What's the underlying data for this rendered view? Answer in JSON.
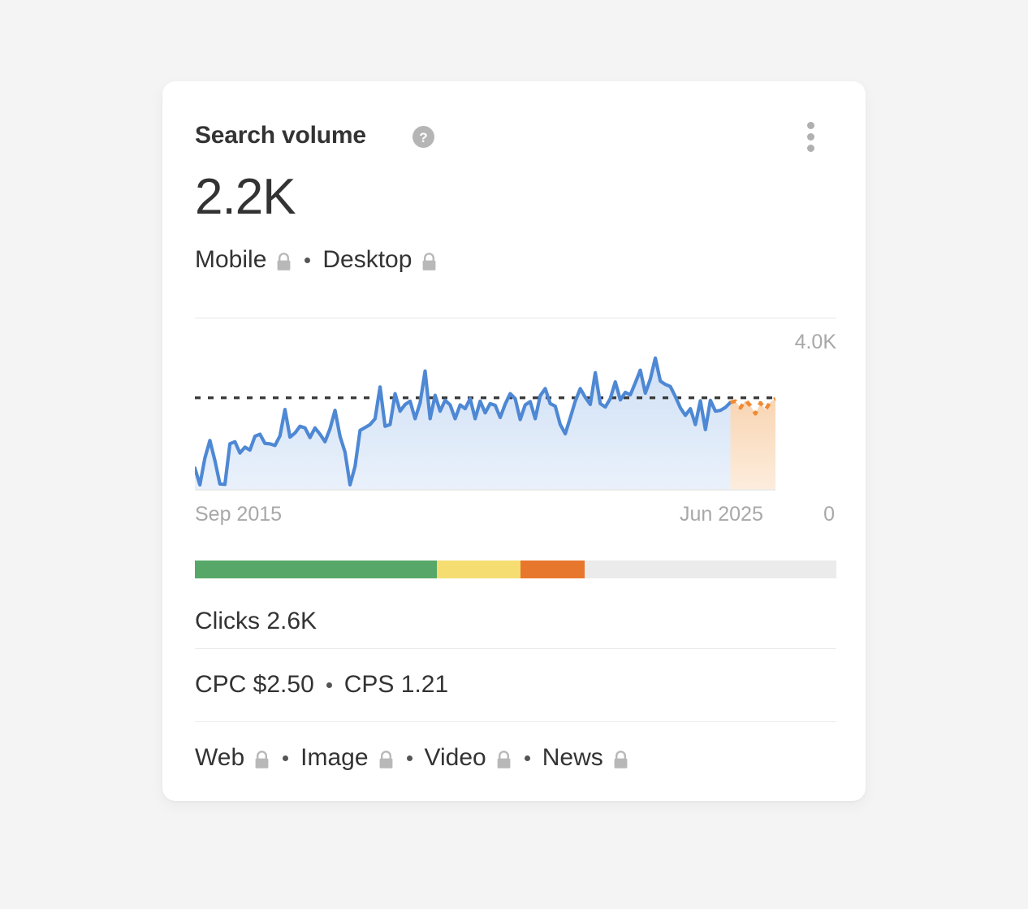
{
  "card": {
    "title": "Search volume",
    "help_icon": "help-circle-icon",
    "menu_icon": "kebab-menu-icon",
    "value": "2.2K",
    "devices": [
      {
        "label": "Mobile",
        "icon": "lock-icon"
      },
      {
        "label": "Desktop",
        "icon": "lock-icon"
      }
    ],
    "separator": "·",
    "clicks_label": "Clicks 2.6K",
    "metrics": [
      {
        "label": "CPC $2.50"
      },
      {
        "label": "CPS 1.21"
      }
    ],
    "result_types": [
      {
        "label": "Web",
        "icon": "lock-icon"
      },
      {
        "label": "Image",
        "icon": "lock-icon"
      },
      {
        "label": "Video",
        "icon": "lock-icon"
      },
      {
        "label": "News",
        "icon": "lock-icon"
      }
    ],
    "difficulty_bar": {
      "segments": [
        {
          "name": "easy",
          "color": "#57a868",
          "percent": 37.7
        },
        {
          "name": "medium",
          "color": "#f5dd72",
          "percent": 13.0
        },
        {
          "name": "hard",
          "color": "#e8772e",
          "percent": 10.1
        },
        {
          "name": "remaining",
          "color": "#ebebeb",
          "percent": 39.2
        }
      ]
    }
  },
  "chart_data": {
    "type": "area",
    "title": "Search volume",
    "xlabel": "",
    "ylabel": "",
    "x_tick_labels": [
      "Sep 2015",
      "Jun 2025"
    ],
    "y_tick_labels": [
      "4.0K",
      "0"
    ],
    "ylim": [
      0,
      4000
    ],
    "grid": false,
    "average_line": 2200,
    "average_line_style": "dashed",
    "line_color": "#4e88d4",
    "fill_color": "#dce7f7",
    "forecast_color": "#f08a33",
    "forecast_fill": "#fbe2cd",
    "forecast_start_index": 107,
    "series": [
      {
        "name": "Search volume",
        "values": [
          520,
          120,
          760,
          1180,
          700,
          140,
          130,
          1100,
          1150,
          880,
          1020,
          950,
          1280,
          1330,
          1110,
          1100,
          1060,
          1290,
          1920,
          1260,
          1360,
          1520,
          1480,
          1250,
          1480,
          1330,
          1150,
          1460,
          1900,
          1280,
          900,
          120,
          560,
          1420,
          1490,
          1560,
          1700,
          2460,
          1520,
          1560,
          2300,
          1880,
          2040,
          2120,
          1700,
          2080,
          2840,
          1700,
          2260,
          1880,
          2140,
          2030,
          1700,
          2030,
          1940,
          2180,
          1700,
          2120,
          1840,
          2060,
          2020,
          1730,
          2050,
          2300,
          2180,
          1680,
          2030,
          2110,
          1700,
          2250,
          2420,
          2060,
          2000,
          1560,
          1340,
          1720,
          2120,
          2420,
          2210,
          2040,
          2800,
          2060,
          1980,
          2180,
          2580,
          2150,
          2330,
          2270,
          2560,
          2860,
          2310,
          2650,
          3150,
          2600,
          2520,
          2470,
          2230,
          1960,
          1780,
          1940,
          1560,
          2130,
          1440,
          2140,
          1880,
          1900,
          1970,
          2090,
          2120,
          1960,
          2140,
          2010,
          1820,
          2080,
          1920,
          2100,
          2180
        ]
      }
    ],
    "annotations": [
      {
        "text": "4.0K",
        "position": "top-right"
      },
      {
        "text": "0",
        "position": "bottom-right"
      },
      {
        "text": "Sep 2015",
        "position": "bottom-left"
      },
      {
        "text": "Jun 2025",
        "position": "bottom-right-axis"
      }
    ]
  }
}
